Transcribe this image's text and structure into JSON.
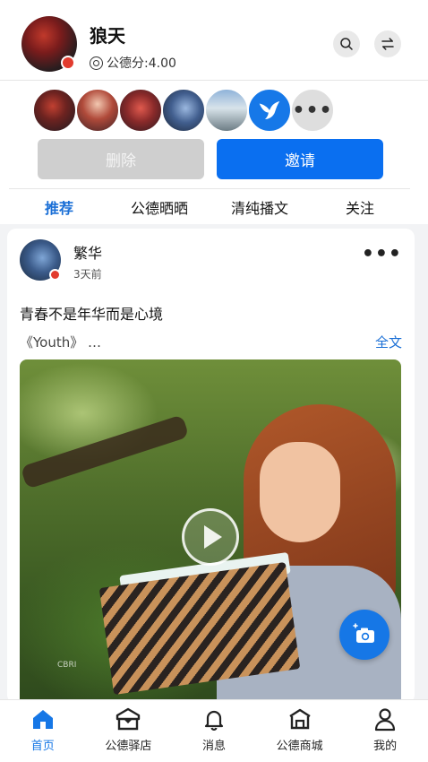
{
  "profile": {
    "name": "狼天",
    "score_label": "公德分:4.00"
  },
  "header_icons": [
    "search-icon",
    "swap-icon"
  ],
  "friends_more_label": "•••",
  "actions": {
    "delete_label": "删除",
    "invite_label": "邀请"
  },
  "tabs": [
    {
      "label": "推荐",
      "active": true
    },
    {
      "label": "公德晒晒",
      "active": false
    },
    {
      "label": "清纯播文",
      "active": false
    },
    {
      "label": "关注",
      "active": false
    }
  ],
  "post": {
    "author": "繁华",
    "time": "3天前",
    "title": "青春不是年华而是心境",
    "excerpt": "《Youth》 …",
    "full_text_link": "全文",
    "media_watermark": "CBRI",
    "more_label": "•••"
  },
  "bottom_nav": [
    {
      "label": "首页",
      "icon": "home-icon",
      "active": true
    },
    {
      "label": "公德驿店",
      "icon": "store-icon",
      "active": false
    },
    {
      "label": "消息",
      "icon": "bell-icon",
      "active": false
    },
    {
      "label": "公德商城",
      "icon": "mall-icon",
      "active": false
    },
    {
      "label": "我的",
      "icon": "person-icon",
      "active": false
    }
  ],
  "colors": {
    "accent": "#0a6ff0",
    "tab_active": "#1a6fd6",
    "delete_bg": "#cfcfcf"
  }
}
